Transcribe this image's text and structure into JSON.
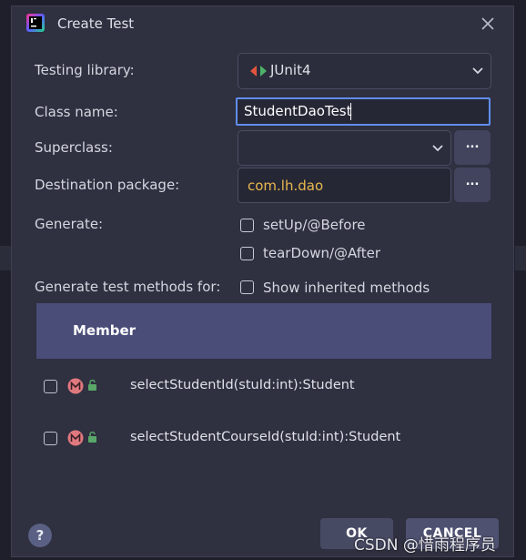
{
  "dialog": {
    "title": "Create Test",
    "icons": {
      "app": "jetbrains-app-icon",
      "close": "close-icon"
    }
  },
  "form": {
    "testing_library": {
      "label": "Testing library:",
      "value": "JUnit4",
      "icon": "junit-icon"
    },
    "class_name": {
      "label": "Class name:",
      "value": "StudentDaoTest"
    },
    "superclass": {
      "label": "Superclass:",
      "value": "",
      "browse": "..."
    },
    "destination_package": {
      "label": "Destination package:",
      "value": "com.lh.dao",
      "browse": "..."
    },
    "generate": {
      "label": "Generate:",
      "setup": {
        "label": "setUp/@Before",
        "checked": false
      },
      "teardown": {
        "label": "tearDown/@After",
        "checked": false
      }
    },
    "methods_for": {
      "label": "Generate test methods for:",
      "show_inherited": {
        "label": "Show inherited methods",
        "checked": false
      }
    }
  },
  "members": {
    "header": "Member",
    "rows": [
      {
        "signature": "selectStudentId(stuId:int):Student",
        "checked": false,
        "icon": "method-icon",
        "visibility_icon": "public-lock-icon"
      },
      {
        "signature": "selectStudentCourseId(stuId:int):Student",
        "checked": false,
        "icon": "method-icon",
        "visibility_icon": "public-lock-icon"
      }
    ]
  },
  "footer": {
    "help": "?",
    "ok": "OK",
    "cancel": "CANCEL"
  },
  "watermark": "CSDN @惜雨程序员",
  "colors": {
    "accent_focus": "#5f8ef2",
    "package_text": "#e8b84f",
    "member_header": "#4a4d78"
  }
}
